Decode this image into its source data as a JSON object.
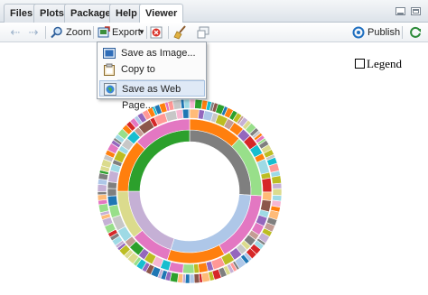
{
  "tabs": [
    {
      "label": "Files",
      "active": false
    },
    {
      "label": "Plots",
      "active": false
    },
    {
      "label": "Packages",
      "active": false
    },
    {
      "label": "Help",
      "active": false
    },
    {
      "label": "Viewer",
      "active": true
    }
  ],
  "toolbar": {
    "zoom_label": "Zoom",
    "export_label": "Export",
    "publish_label": "Publish"
  },
  "export_menu": {
    "items": [
      {
        "label": "Save as Image...",
        "icon": "image-icon",
        "highlighted": false
      },
      {
        "label": "Copy to Clipboard...",
        "icon": "clipboard-icon",
        "highlighted": false
      },
      {
        "label": "Save as Web Page...",
        "icon": "globe-icon",
        "highlighted": true
      }
    ]
  },
  "legend": {
    "label": "Legend",
    "checked": false
  },
  "colors": {
    "accent_blue": "#1f5fae",
    "menu_highlight": "#dfe9f6",
    "palette": [
      "#1f77b4",
      "#ff7f0e",
      "#2ca02c",
      "#d62728",
      "#9467bd",
      "#8c564b",
      "#e377c2",
      "#7f7f7f",
      "#bcbd22",
      "#17becf",
      "#aec7e8",
      "#ffbb78",
      "#98df8a",
      "#ff9896",
      "#c5b0d5",
      "#c49c94",
      "#f7b6d2",
      "#c7c7c7",
      "#dbdb8d",
      "#9edae5"
    ]
  }
}
